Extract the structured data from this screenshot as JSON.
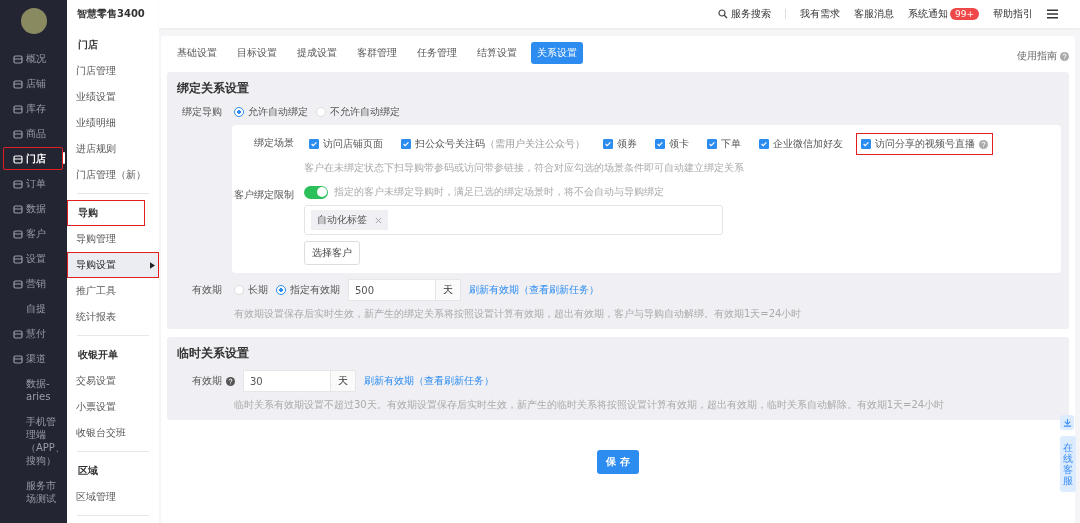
{
  "app": {
    "title": "智慧零售3400"
  },
  "topbar": {
    "search": "服务搜索",
    "links": [
      "我有需求",
      "客服消息"
    ],
    "notice": {
      "label": "系统通知",
      "badge": "99+"
    },
    "help": "帮助指引"
  },
  "nav": [
    {
      "label": "概况",
      "kind": "icon",
      "selected": false,
      "highlighted": false
    },
    {
      "label": "店铺",
      "kind": "icon",
      "selected": false,
      "highlighted": false
    },
    {
      "label": "库存",
      "kind": "icon",
      "selected": false,
      "highlighted": false
    },
    {
      "label": "商品",
      "kind": "icon",
      "selected": false,
      "highlighted": false
    },
    {
      "label": "门店",
      "kind": "icon",
      "selected": true,
      "highlighted": true
    },
    {
      "label": "订单",
      "kind": "icon",
      "selected": false,
      "highlighted": false
    },
    {
      "label": "数据",
      "kind": "icon",
      "selected": false,
      "highlighted": false
    },
    {
      "label": "客户",
      "kind": "icon",
      "selected": false,
      "highlighted": false
    },
    {
      "label": "设置",
      "kind": "icon",
      "selected": false,
      "highlighted": false
    },
    {
      "label": "营销",
      "kind": "icon",
      "selected": false,
      "highlighted": false
    },
    {
      "label": "自提",
      "kind": "text",
      "selected": false,
      "highlighted": false
    },
    {
      "label": "慧付",
      "kind": "icon",
      "selected": false,
      "highlighted": false
    },
    {
      "label": "渠道",
      "kind": "icon",
      "selected": false,
      "highlighted": false
    },
    {
      "label": "数据-aries",
      "kind": "text",
      "selected": false,
      "highlighted": false
    },
    {
      "label": "手机管理端（APP、搜狗）",
      "kind": "text",
      "selected": false,
      "highlighted": false
    },
    {
      "label": "服务市场测试",
      "kind": "text",
      "selected": false,
      "highlighted": false
    }
  ],
  "subnav": [
    {
      "title": "门店",
      "highlighted": false,
      "items": [
        {
          "label": "门店管理",
          "selected": false,
          "highlighted": false,
          "arrow": false
        },
        {
          "label": "业绩设置",
          "selected": false,
          "highlighted": false,
          "arrow": false
        },
        {
          "label": "业绩明细",
          "selected": false,
          "highlighted": false,
          "arrow": false
        },
        {
          "label": "进店规则",
          "selected": false,
          "highlighted": false,
          "arrow": false
        },
        {
          "label": "门店管理（新）",
          "selected": false,
          "highlighted": false,
          "arrow": false
        }
      ]
    },
    {
      "title": "导购",
      "highlighted": true,
      "items": [
        {
          "label": "导购管理",
          "selected": false,
          "highlighted": false,
          "arrow": false
        },
        {
          "label": "导购设置",
          "selected": true,
          "highlighted": true,
          "arrow": true
        },
        {
          "label": "推广工具",
          "selected": false,
          "highlighted": false,
          "arrow": false
        },
        {
          "label": "统计报表",
          "selected": false,
          "highlighted": false,
          "arrow": false
        }
      ]
    },
    {
      "title": "收银开单",
      "highlighted": false,
      "items": [
        {
          "label": "交易设置",
          "selected": false,
          "highlighted": false,
          "arrow": false
        },
        {
          "label": "小票设置",
          "selected": false,
          "highlighted": false,
          "arrow": false
        },
        {
          "label": "收银台交班",
          "selected": false,
          "highlighted": false,
          "arrow": false
        }
      ]
    },
    {
      "title": "区域",
      "highlighted": false,
      "items": [
        {
          "label": "区域管理",
          "selected": false,
          "highlighted": false,
          "arrow": false
        }
      ]
    }
  ],
  "tabs": [
    {
      "label": "基础设置",
      "selected": false
    },
    {
      "label": "目标设置",
      "selected": false
    },
    {
      "label": "提成设置",
      "selected": false
    },
    {
      "label": "客群管理",
      "selected": false
    },
    {
      "label": "任务管理",
      "selected": false
    },
    {
      "label": "结算设置",
      "selected": false
    },
    {
      "label": "关系设置",
      "selected": true
    }
  ],
  "guide": "使用指南",
  "binding": {
    "title": "绑定关系设置",
    "label": "绑定导购",
    "options": [
      {
        "label": "允许自动绑定",
        "selected": true
      },
      {
        "label": "不允许自动绑定",
        "selected": false
      }
    ],
    "scene": {
      "label": "绑定场景",
      "hint": "客户在未绑定状态下扫导购带参码或访问带参链接，符合对应勾选的场景条件即可自动建立绑定关系",
      "options": [
        {
          "label": "访问店铺页面",
          "checked": true,
          "highlighted": false,
          "help": false
        },
        {
          "label": "扫公众号关注码",
          "note": "（需用户关注公众号）",
          "checked": true,
          "highlighted": false,
          "help": false
        },
        {
          "label": "领券",
          "checked": true,
          "highlighted": false,
          "help": false
        },
        {
          "label": "领卡",
          "checked": true,
          "highlighted": false,
          "help": false
        },
        {
          "label": "下单",
          "checked": true,
          "highlighted": false,
          "help": false
        },
        {
          "label": "企业微信加好友",
          "checked": true,
          "highlighted": false,
          "help": false
        },
        {
          "label": "访问分享的视频号直播",
          "checked": true,
          "highlighted": true,
          "help": true
        }
      ]
    },
    "limit": {
      "label": "客户绑定限制",
      "on": true,
      "hint": "指定的客户未绑定导购时，满足已选的绑定场景时，将不会自动与导购绑定",
      "tags": [
        "自动化标签"
      ],
      "button": "选择客户"
    },
    "validity": {
      "label": "有效期",
      "options": [
        {
          "label": "长期",
          "selected": false
        },
        {
          "label": "指定有效期",
          "selected": true
        }
      ],
      "value": "500",
      "unit": "天",
      "link": "刷新有效期（查看刷新任务）",
      "hint": "有效期设置保存后实时生效，新产生的绑定关系将按照设置计算有效期，超出有效期，客户与导购自动解绑。有效期1天=24小时"
    }
  },
  "temp": {
    "title": "临时关系设置",
    "label": "有效期",
    "value": "30",
    "unit": "天",
    "link": "刷新有效期（查看刷新任务）",
    "hint": "临时关系有效期设置不超过30天。有效期设置保存后实时生效，新产生的临时关系将按照设置计算有效期，超出有效期，临时关系自动解除。有效期1天=24小时"
  },
  "save": "保 存",
  "float": {
    "chat": "在线客服"
  }
}
